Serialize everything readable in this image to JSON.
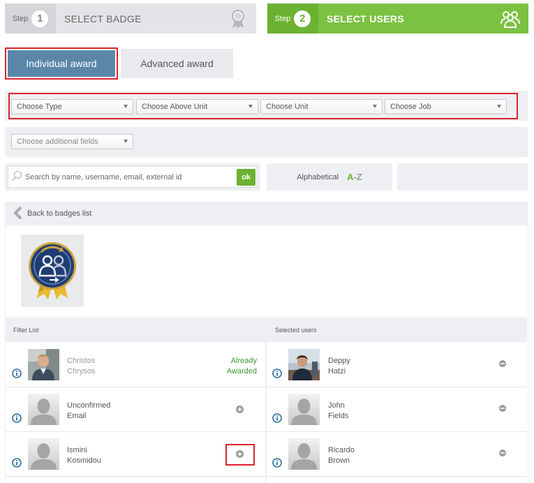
{
  "steps": [
    {
      "word": "Step",
      "number": "1",
      "label": "SELECT BADGE",
      "icon": "badge-ribbon-icon"
    },
    {
      "word": "Step",
      "number": "2",
      "label": "SELECT USERS",
      "icon": "users-group-icon"
    }
  ],
  "award_tabs": {
    "individual": "Individual award",
    "advanced": "Advanced award"
  },
  "filters": {
    "type": "Choose Type",
    "above_unit": "Choose Above Unit",
    "unit": "Choose Unit",
    "job": "Choose Job",
    "additional": "Choose additional fields"
  },
  "search": {
    "placeholder": "Search by name, username, email, external id",
    "ok_label": "ok"
  },
  "sort": {
    "label": "Alphabetical",
    "a": "A",
    "dash": "-",
    "z": "Z"
  },
  "back": {
    "label": "Back to badges list",
    "icon": "chevron-left-icon"
  },
  "badge": {
    "icon": "user-award-badge-icon",
    "accent": "#1f3d73",
    "ribbon": "#e8b830"
  },
  "filter_list": {
    "header": "Filter List",
    "users": [
      {
        "first": "Christos",
        "last": "Chrysos",
        "status_line1": "Already",
        "status_line2": "Awarded",
        "photo": true
      },
      {
        "first": "Unconfirmed",
        "last": "Email",
        "photo": false
      },
      {
        "first": "Ismini",
        "last": "Kosmidou",
        "photo": false
      }
    ]
  },
  "selected": {
    "header": "Selected users",
    "users": [
      {
        "first": "Deppy",
        "last": "Hatzi",
        "photo": true
      },
      {
        "first": "John",
        "last": "Fields",
        "photo": false
      },
      {
        "first": "Ricardo",
        "last": "Brown",
        "photo": false
      }
    ]
  },
  "colors": {
    "green": "#7cc242",
    "blue": "#5a87a8",
    "highlight": "#d9252b",
    "info": "#2f6e9e"
  }
}
